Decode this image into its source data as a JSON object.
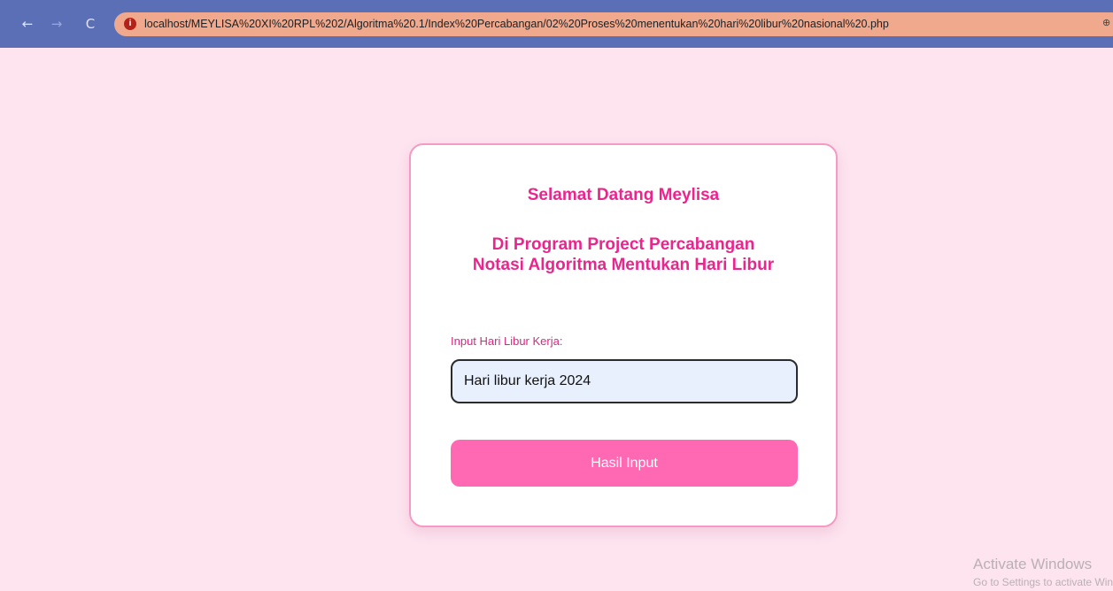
{
  "browser": {
    "url": "localhost/MEYLISA%20XI%20RPL%202/Algoritma%20.1/Index%20Percabangan/02%20Proses%20menentukan%20hari%20libur%20nasional%20.php",
    "back_icon": "←",
    "forward_icon": "→",
    "reload_icon": "C",
    "info_icon": "i",
    "right_icon": "⊕"
  },
  "form": {
    "title": "Selamat Datang Meylisa",
    "subtitle": "Di Program Project Percabangan Notasi Algoritma Mentukan Hari Libur",
    "input_label": "Input Hari Libur Kerja:",
    "input_value": "Hari libur kerja 2024",
    "submit_label": "Hasil Input"
  },
  "watermark": {
    "title": "Activate Windows",
    "subtitle": "Go to Settings to activate Windows."
  },
  "colors": {
    "page_background": "#fde4ef",
    "accent": "#e8268c",
    "button": "#ff69b4",
    "card_border": "#f59ac4"
  }
}
